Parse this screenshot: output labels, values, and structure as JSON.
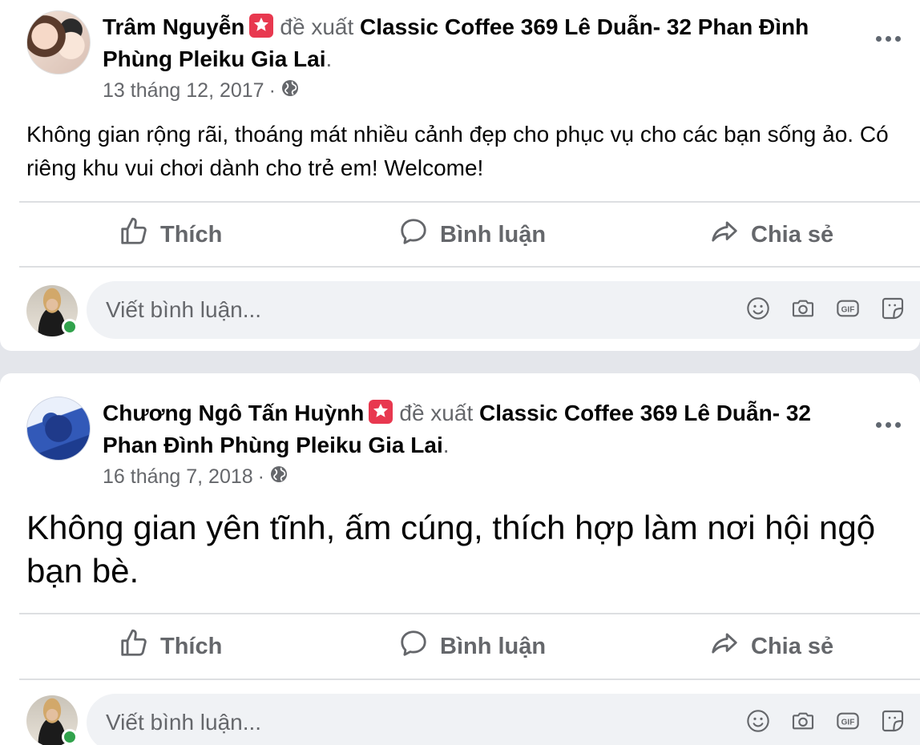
{
  "posts": [
    {
      "author": "Trâm Nguyễn",
      "verb": "đề xuất",
      "place": "Classic Coffee 369 Lê Duẫn- 32 Phan Đình Phùng Pleiku Gia Lai",
      "date": "13 tháng 12, 2017",
      "separator": "·",
      "text": "Không gian rộng rãi, thoáng mát nhiều cảnh đẹp cho phục vụ cho các bạn sống ảo. Có riêng khu vui chơi dành cho trẻ em! Welcome!"
    },
    {
      "author": "Chương Ngô Tấn Huỳnh",
      "verb": "đề xuất",
      "place": "Classic Coffee 369 Lê Duẫn- 32 Phan Đình Phùng Pleiku Gia Lai",
      "date": "16 tháng 7, 2018",
      "separator": "·",
      "text": "Không gian yên tĩnh, ấm cúng, thích hợp làm nơi hội ngộ bạn bè."
    }
  ],
  "actions": {
    "like": "Thích",
    "comment": "Bình luận",
    "share": "Chia sẻ"
  },
  "composer": {
    "placeholder": "Viết bình luận..."
  },
  "icons": {
    "badge": "recommend-star-icon",
    "audience": "globe-icon",
    "more": "more-options-icon",
    "like": "thumbs-up-icon",
    "comment": "comment-bubble-icon",
    "share": "share-arrow-icon",
    "emoji": "emoji-icon",
    "camera": "camera-icon",
    "gif": "gif-icon",
    "sticker": "sticker-icon"
  },
  "colors": {
    "badge": "#e8384f",
    "online": "#31a24c",
    "secondary_text": "#65676b"
  }
}
